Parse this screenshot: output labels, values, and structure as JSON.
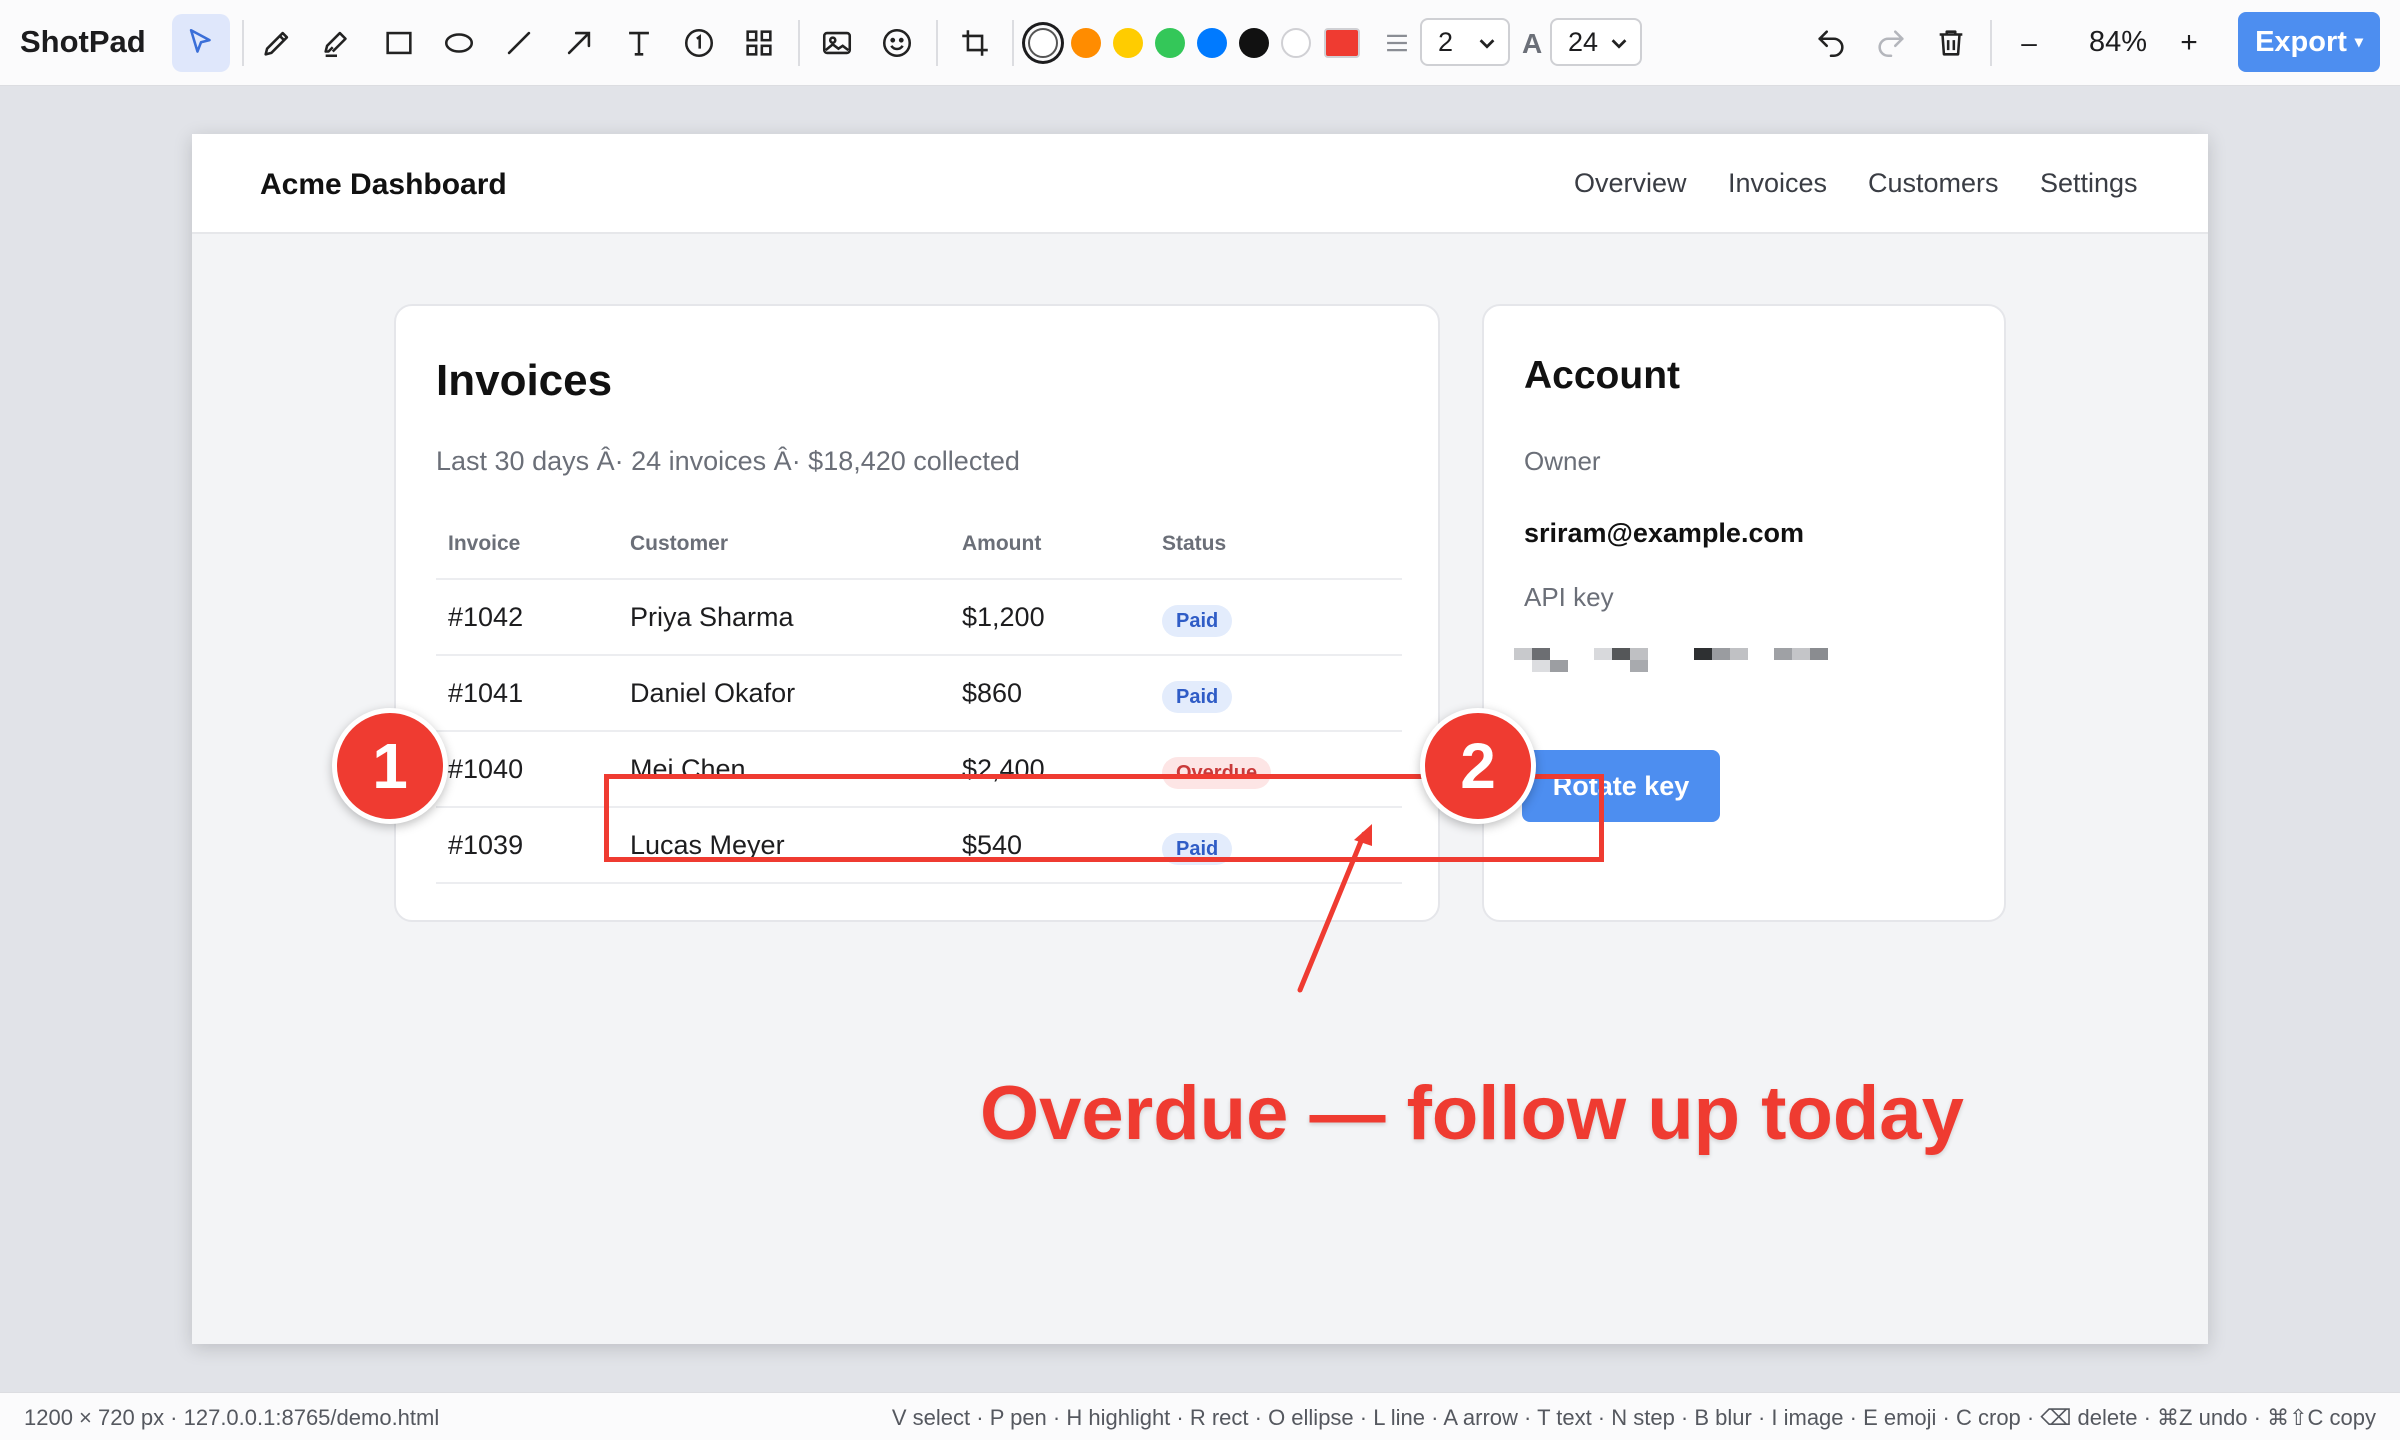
{
  "app": {
    "title": "ShotPad"
  },
  "toolbar": {
    "tools": [
      {
        "name": "select-tool",
        "icon": "cursor-icon",
        "active": true
      },
      {
        "name": "pen-tool",
        "icon": "pencil-icon"
      },
      {
        "name": "highlight-tool",
        "icon": "highlighter-icon"
      },
      {
        "name": "rect-tool",
        "icon": "rectangle-icon"
      },
      {
        "name": "ellipse-tool",
        "icon": "ellipse-icon"
      },
      {
        "name": "line-tool",
        "icon": "line-icon"
      },
      {
        "name": "arrow-tool",
        "icon": "arrow-icon"
      },
      {
        "name": "text-tool",
        "icon": "text-icon"
      },
      {
        "name": "step-tool",
        "icon": "step-number-icon"
      },
      {
        "name": "blur-tool",
        "icon": "blur-grid-icon"
      },
      {
        "name": "image-tool",
        "icon": "image-icon"
      },
      {
        "name": "emoji-tool",
        "icon": "emoji-icon"
      },
      {
        "name": "crop-tool",
        "icon": "crop-icon"
      }
    ],
    "colors": [
      "#ffffff",
      "#ff8c00",
      "#ffcc00",
      "#34c759",
      "#007aff",
      "#111111",
      "#ffffff"
    ],
    "selected_color_index": 0,
    "custom_color": "#ef3b31",
    "stroke_width": "2",
    "font_size": "24",
    "font_size_icon_label": "A",
    "zoom_level": "84%",
    "zoom_out_label": "–",
    "zoom_in_label": "+",
    "export_label": "Export",
    "export_caret": "▾"
  },
  "page": {
    "brand": "Acme Dashboard",
    "nav": [
      "Overview",
      "Invoices",
      "Customers",
      "Settings"
    ],
    "invoices": {
      "title": "Invoices",
      "summary": "Last 30 days Â· 24 invoices Â· $18,420 collected",
      "columns": [
        "Invoice",
        "Customer",
        "Amount",
        "Status"
      ],
      "rows": [
        {
          "invoice": "#1042",
          "customer": "Priya Sharma",
          "amount": "$1,200",
          "status": "Paid"
        },
        {
          "invoice": "#1041",
          "customer": "Daniel Okafor",
          "amount": "$860",
          "status": "Paid"
        },
        {
          "invoice": "#1040",
          "customer": "Mei Chen",
          "amount": "$2,400",
          "status": "Overdue"
        },
        {
          "invoice": "#1039",
          "customer": "Lucas Meyer",
          "amount": "$540",
          "status": "Paid"
        }
      ]
    },
    "account": {
      "title": "Account",
      "owner_label": "Owner",
      "owner_value": "sriram@example.com",
      "api_key_label": "API key",
      "rotate_button": "Rotate key"
    }
  },
  "annotations": {
    "step1": "1",
    "step2": "2",
    "callout_text": "Overdue — follow up today",
    "color": "#ef3b31"
  },
  "statusbar": {
    "left": "1200 × 720 px · 127.0.0.1:8765/demo.html",
    "right": "V select · P pen · H highlight · R rect · O ellipse · L line · A arrow · T text · N step · B blur · I image · E emoji · C crop · ⌫ delete · ⌘Z undo · ⌘⇧C copy"
  }
}
